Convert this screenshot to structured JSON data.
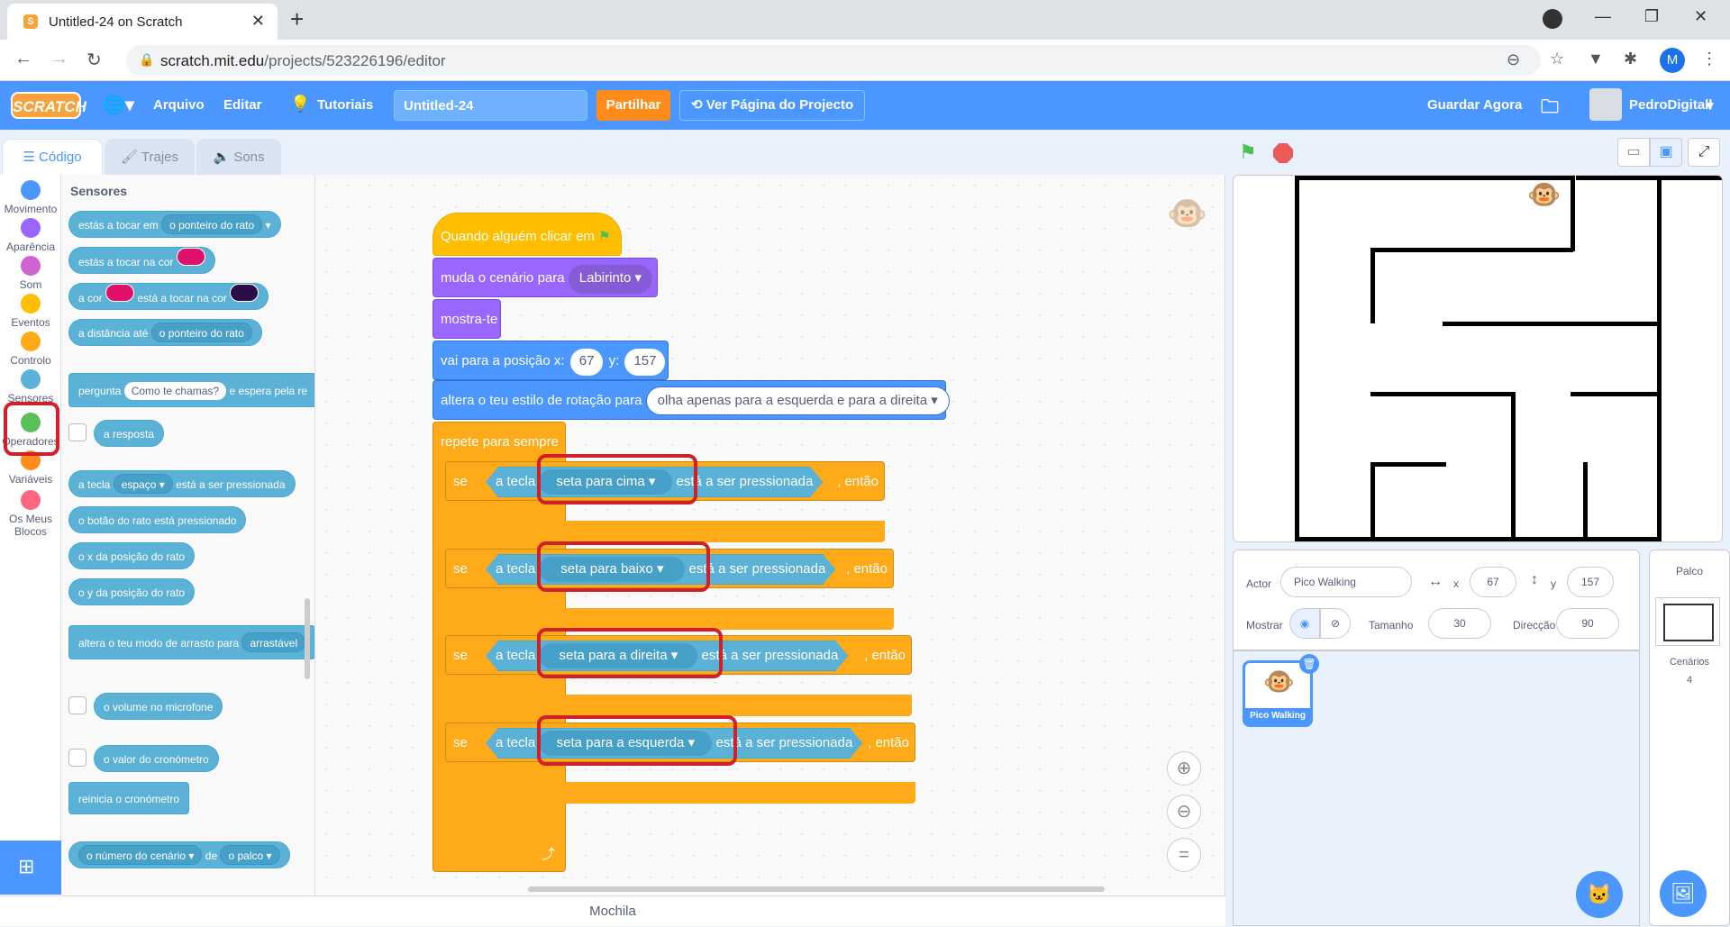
{
  "browser": {
    "tab_title": "Untitled-24 on Scratch",
    "url_host": "scratch.mit.edu",
    "url_path": "/projects/523226196/editor",
    "profile_initial": "M"
  },
  "menu": {
    "logo": "SCRATCH",
    "file": "Arquivo",
    "edit": "Editar",
    "tutorials": "Tutoriais",
    "project_title": "Untitled-24",
    "share": "Partilhar",
    "see_project": "Ver Página do Projecto",
    "save_now": "Guardar Agora",
    "username": "PedroDigitall"
  },
  "tabs": {
    "code": "Código",
    "costumes": "Trajes",
    "sounds": "Sons"
  },
  "categories": [
    {
      "label": "Movimento",
      "color": "#4c97ff"
    },
    {
      "label": "Aparência",
      "color": "#9966ff"
    },
    {
      "label": "Som",
      "color": "#cf63cf"
    },
    {
      "label": "Eventos",
      "color": "#ffbf00"
    },
    {
      "label": "Controlo",
      "color": "#ffab19"
    },
    {
      "label": "Sensores",
      "color": "#5cb1d6"
    },
    {
      "label": "Operadores",
      "color": "#59c059"
    },
    {
      "label": "Variáveis",
      "color": "#ff8c1a"
    },
    {
      "label": "Os Meus Blocos",
      "color": "#ff6680"
    }
  ],
  "palette": {
    "heading": "Sensores",
    "touching": "estás a tocar em",
    "mouse_pointer": "o ponteiro do rato",
    "touching_color": "estás a tocar na cor",
    "color_pre": "a cor",
    "color_post": "está a tocar na cor",
    "distance": "a distância até",
    "ask": "pergunta",
    "ask_default": "Como te chamas?",
    "ask_post": "e espera pela re",
    "answer": "a resposta",
    "key": "a tecla",
    "space": "espaço",
    "key_pressed": "está a ser pressionada",
    "mouse_down": "o botão do rato está pressionado",
    "mouse_x": "o x da posição do rato",
    "mouse_y": "o y da posição do rato",
    "drag_mode": "altera o teu modo de arrasto para",
    "draggable": "arrastável",
    "loudness": "o volume no microfone",
    "timer": "o valor do cronómetro",
    "reset_timer": "reinicia o cronómetro",
    "backdrop_number": "o número do cenário",
    "of": "de",
    "stage": "o palco",
    "pink": "#e0116b",
    "dark": "#2b0d4a"
  },
  "script": {
    "when_flag": "Quando alguém clicar em",
    "switch_backdrop": "muda o cenário para",
    "backdrop": "Labirinto",
    "show": "mostra-te",
    "goto": "vai para a posição x:",
    "x": "67",
    "y_label": "y:",
    "y": "157",
    "rotation": "altera o teu estilo de rotação para",
    "rotation_opt": "olha apenas para a esquerda e para a direita",
    "forever": "repete para sempre",
    "if": "se",
    "key": "a tecla",
    "pressed": "está a ser pressionada",
    "then": ", então",
    "keys": [
      "seta para cima",
      "seta para baixo",
      "seta para a direita",
      "seta para a esquerda"
    ]
  },
  "backpack": "Mochila",
  "sprite": {
    "actor_label": "Actor",
    "name": "Pico Walking",
    "x_label": "x",
    "x": "67",
    "y_label": "y",
    "y": "157",
    "show_label": "Mostrar",
    "size_label": "Tamanho",
    "size": "30",
    "direction_label": "Direcção",
    "direction": "90"
  },
  "stage_pane": {
    "title": "Palco",
    "backdrops_label": "Cenários",
    "backdrops_count": "4"
  }
}
